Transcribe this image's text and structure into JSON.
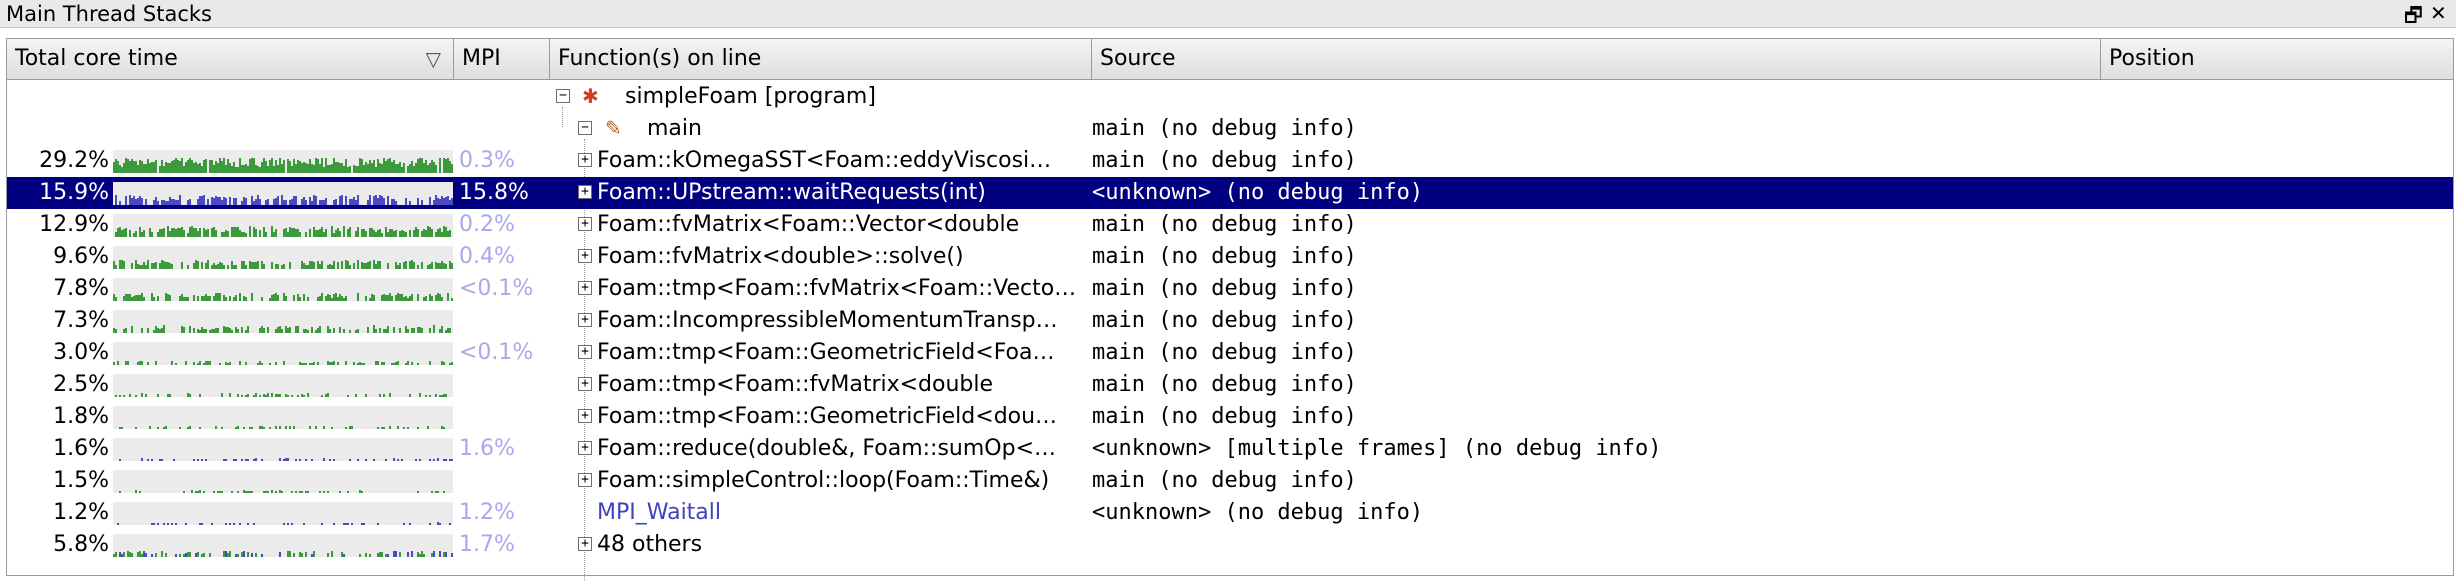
{
  "window": {
    "title": "Main Thread Stacks",
    "restore_glyph": "🗗",
    "close_glyph": "✕"
  },
  "columns": {
    "total_core_time": "Total core time",
    "mpi": "MPI",
    "functions": "Function(s) on line",
    "source": "Source",
    "position": "Position",
    "sort_glyph": "▽"
  },
  "colors": {
    "compute": "#3c9a3c",
    "mpi": "#4a4ac4",
    "selection": "#000080",
    "mpi_text": "#a9a9e8"
  },
  "tree": {
    "program": {
      "label": "simpleFoam [program]",
      "icon": "program-icon"
    },
    "main": {
      "label": "main",
      "icon": "function-icon",
      "source": "main (no debug info)"
    }
  },
  "rows": [
    {
      "pct": "29.2%",
      "mpi": "0.3%",
      "func": "Foam::kOmegaSST<Foam::eddyViscosi…",
      "source": "main (no debug info)",
      "expandable": true,
      "selected": false,
      "bar_color": "#3c9a3c",
      "mpi_fraction": 0.0,
      "density": 0.85
    },
    {
      "pct": "15.9%",
      "mpi": "15.8%",
      "func": "Foam::UPstream::waitRequests(int)",
      "source": "<unknown> (no debug info)",
      "expandable": true,
      "selected": true,
      "bar_color": "#4a4ac4",
      "mpi_fraction": 1.0,
      "density": 0.55
    },
    {
      "pct": "12.9%",
      "mpi": "0.2%",
      "func": "Foam::fvMatrix<Foam::Vector<double",
      "source": "main (no debug info)",
      "expandable": true,
      "selected": false,
      "bar_color": "#3c9a3c",
      "mpi_fraction": 0.0,
      "density": 0.6
    },
    {
      "pct": "9.6%",
      "mpi": "0.4%",
      "func": "Foam::fvMatrix<double>::solve()",
      "source": "main (no debug info)",
      "expandable": true,
      "selected": false,
      "bar_color": "#3c9a3c",
      "mpi_fraction": 0.0,
      "density": 0.5
    },
    {
      "pct": "7.8%",
      "mpi": "<0.1%",
      "func": "Foam::tmp<Foam::fvMatrix<Foam::Vecto…",
      "source": "main (no debug info)",
      "expandable": true,
      "selected": false,
      "bar_color": "#3c9a3c",
      "mpi_fraction": 0.0,
      "density": 0.45
    },
    {
      "pct": "7.3%",
      "mpi": "",
      "func": "Foam::IncompressibleMomentumTransp…",
      "source": "main (no debug info)",
      "expandable": true,
      "selected": false,
      "bar_color": "#3c9a3c",
      "mpi_fraction": 0.0,
      "density": 0.42
    },
    {
      "pct": "3.0%",
      "mpi": "<0.1%",
      "func": "Foam::tmp<Foam::GeometricField<Foa…",
      "source": "main (no debug info)",
      "expandable": true,
      "selected": false,
      "bar_color": "#3c9a3c",
      "mpi_fraction": 0.0,
      "density": 0.25
    },
    {
      "pct": "2.5%",
      "mpi": "",
      "func": "Foam::tmp<Foam::fvMatrix<double",
      "source": "main (no debug info)",
      "expandable": true,
      "selected": false,
      "bar_color": "#3c9a3c",
      "mpi_fraction": 0.0,
      "density": 0.22
    },
    {
      "pct": "1.8%",
      "mpi": "",
      "func": "Foam::tmp<Foam::GeometricField<dou…",
      "source": "main (no debug info)",
      "expandable": true,
      "selected": false,
      "bar_color": "#3c9a3c",
      "mpi_fraction": 0.0,
      "density": 0.18
    },
    {
      "pct": "1.6%",
      "mpi": "1.6%",
      "func": "Foam::reduce(double&, Foam::sumOp<…",
      "source": "<unknown> [multiple frames] (no debug info)",
      "expandable": true,
      "selected": false,
      "bar_color": "#4a4ac4",
      "mpi_fraction": 1.0,
      "density": 0.16
    },
    {
      "pct": "1.5%",
      "mpi": "",
      "func": "Foam::simpleControl::loop(Foam::Time&)",
      "source": "main (no debug info)",
      "expandable": true,
      "selected": false,
      "bar_color": "#3c9a3c",
      "mpi_fraction": 0.0,
      "density": 0.15
    },
    {
      "pct": "1.2%",
      "mpi": "1.2%",
      "func": "MPI_Waitall",
      "source": "<unknown> (no debug info)",
      "expandable": false,
      "selected": false,
      "bar_color": "#4a4ac4",
      "mpi_fraction": 1.0,
      "density": 0.14
    },
    {
      "pct": "5.8%",
      "mpi": "1.7%",
      "func": "48 others",
      "source": "",
      "expandable": true,
      "selected": false,
      "bar_color": "#3c9a3c",
      "mpi_fraction": 0.3,
      "density": 0.35
    }
  ]
}
